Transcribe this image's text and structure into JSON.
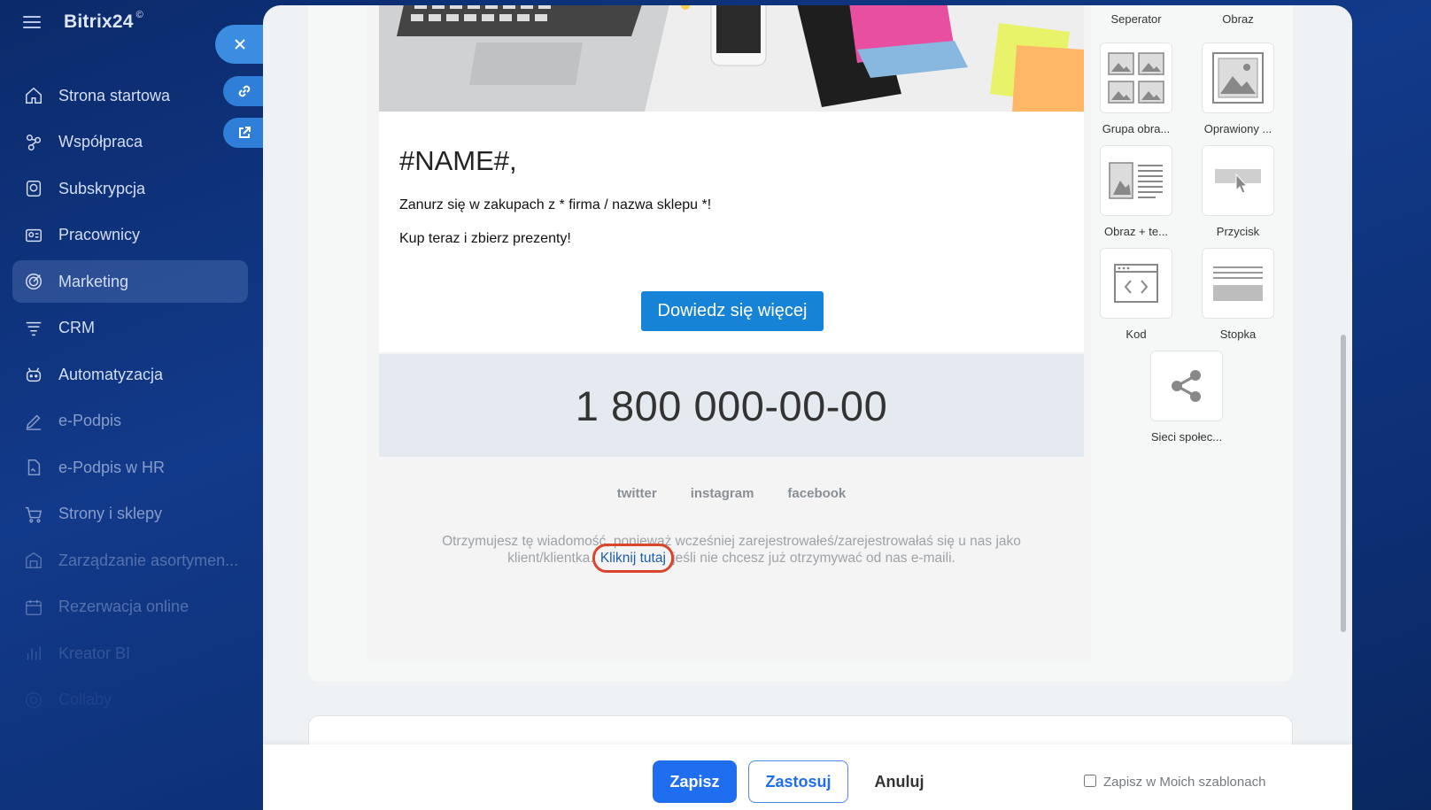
{
  "app": {
    "brand": "Bitrix24",
    "brand_mark": "©"
  },
  "sidebar": {
    "items": [
      {
        "label": "Strona startowa",
        "icon": "home-icon"
      },
      {
        "label": "Współpraca",
        "icon": "collab-icon"
      },
      {
        "label": "Subskrypcja",
        "icon": "subscription-icon"
      },
      {
        "label": "Pracownicy",
        "icon": "employees-icon"
      },
      {
        "label": "Marketing",
        "icon": "marketing-icon",
        "active": true
      },
      {
        "label": "CRM",
        "icon": "crm-icon"
      },
      {
        "label": "Automatyzacja",
        "icon": "automation-icon"
      },
      {
        "label": "e-Podpis",
        "icon": "esign-icon"
      },
      {
        "label": "e-Podpis w HR",
        "icon": "esign-hr-icon"
      },
      {
        "label": "Strony i sklepy",
        "icon": "cart-icon"
      },
      {
        "label": "Zarządzanie asortymen...",
        "icon": "inventory-icon"
      },
      {
        "label": "Rezerwacja online",
        "icon": "calendar-icon"
      },
      {
        "label": "Kreator BI",
        "icon": "chart-icon"
      },
      {
        "label": "Collaby",
        "icon": "collaby-icon"
      }
    ]
  },
  "email": {
    "title": "#NAME#,",
    "line1": "Zanurz się w zakupach z * firma / nazwa sklepu *!",
    "line2": "Kup teraz i zbierz prezenty!",
    "cta": "Dowiedz się więcej",
    "phone": "1 800 000-00-00",
    "socials": [
      "twitter",
      "instagram",
      "facebook"
    ],
    "unsub_before": "Otrzymujesz tę wiadomość, ponieważ wcześniej zarejestrowałeś/zarejestrowałaś się u nas jako klient/klientka.",
    "unsub_link": "Kliknij tutaj",
    "unsub_after": "jeśli nie chcesz już otrzymywać od nas e-maili."
  },
  "palette": {
    "top_labels": [
      "Seperator",
      "Obraz"
    ],
    "blocks": [
      {
        "label": "Grupa obra...",
        "icon": "image-group-icon"
      },
      {
        "label": "Oprawiony ...",
        "icon": "framed-image-icon"
      },
      {
        "label": "Obraz + te...",
        "icon": "image-text-icon"
      },
      {
        "label": "Przycisk",
        "icon": "button-block-icon"
      },
      {
        "label": "Kod",
        "icon": "code-icon"
      },
      {
        "label": "Stopka",
        "icon": "footer-block-icon"
      },
      {
        "label": "Sieci społec...",
        "icon": "share-icon"
      }
    ]
  },
  "footer": {
    "save": "Zapisz",
    "apply": "Zastosuj",
    "cancel": "Anuluj",
    "save_template": "Zapisz w Moich szablonach"
  }
}
